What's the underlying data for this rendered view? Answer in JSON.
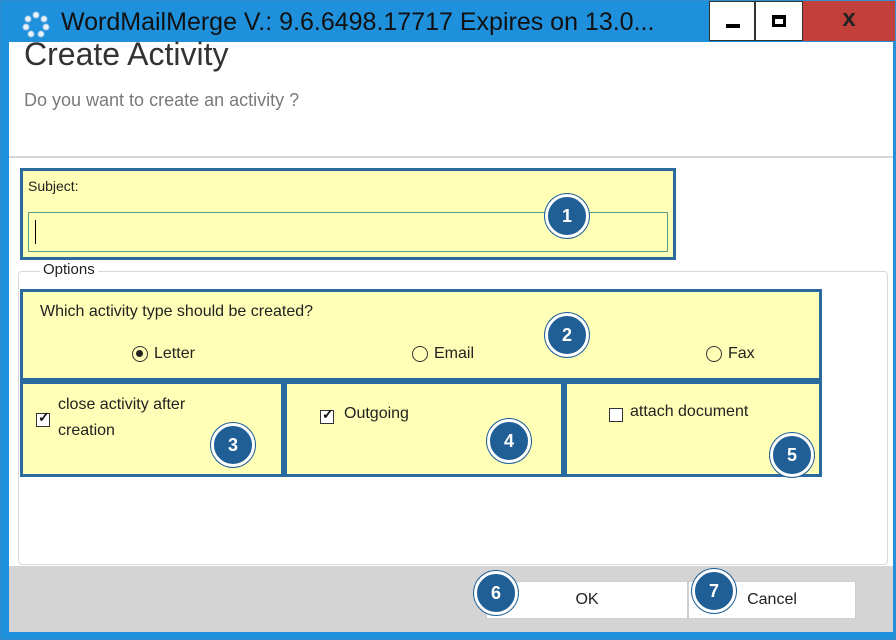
{
  "window": {
    "title": "WordMailMerge V.: 9.6.6498.17717 Expires on 13.0...",
    "close_glyph": "x",
    "icon": "gear-dots-icon"
  },
  "header": {
    "title": "Create Activity",
    "subtitle": "Do you want to create an activity ?"
  },
  "subject": {
    "label": "Subject:",
    "value": "",
    "placeholder": ""
  },
  "options": {
    "legend": "Options",
    "question": "Which activity type should be created?",
    "activity_types": [
      {
        "label": "Letter",
        "selected": true
      },
      {
        "label": "Email",
        "selected": false
      },
      {
        "label": "Fax",
        "selected": false
      }
    ],
    "close_after_creation": {
      "label_line1": "close activity after",
      "label_line2": "creation",
      "checked": true
    },
    "outgoing": {
      "label": "Outgoing",
      "checked": true
    },
    "attach_document": {
      "label": "attach document",
      "checked": false
    }
  },
  "buttons": {
    "ok": "OK",
    "cancel": "Cancel"
  },
  "callouts": [
    "1",
    "2",
    "3",
    "4",
    "5",
    "6",
    "7"
  ],
  "colors": {
    "titlebar": "#1e90dc",
    "highlight_fill": "#ffffb7",
    "highlight_border": "#2a6a9e",
    "badge": "#1f5f95",
    "close_button": "#c1403a",
    "footer": "#d4d4d4"
  }
}
